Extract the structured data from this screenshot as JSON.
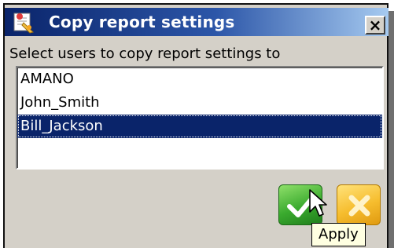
{
  "window": {
    "title": "Copy report settings",
    "close_label": "×"
  },
  "instruction": "Select users to copy report settings to",
  "users": [
    {
      "name": "AMANO",
      "selected": false
    },
    {
      "name": "John_Smith",
      "selected": false
    },
    {
      "name": "Bill_Jackson",
      "selected": true
    }
  ],
  "actions": {
    "apply_icon": "green-checkmark-icon",
    "cancel_icon": "orange-x-icon",
    "tooltip": "Apply"
  },
  "colors": {
    "title_bar": "#0a246a",
    "selection": "#0a246a",
    "dialog_bg": "#d4d0c8",
    "apply_green": "#3aaa2e",
    "cancel_orange": "#f6bd2e",
    "tooltip_bg": "#ffffe1"
  }
}
